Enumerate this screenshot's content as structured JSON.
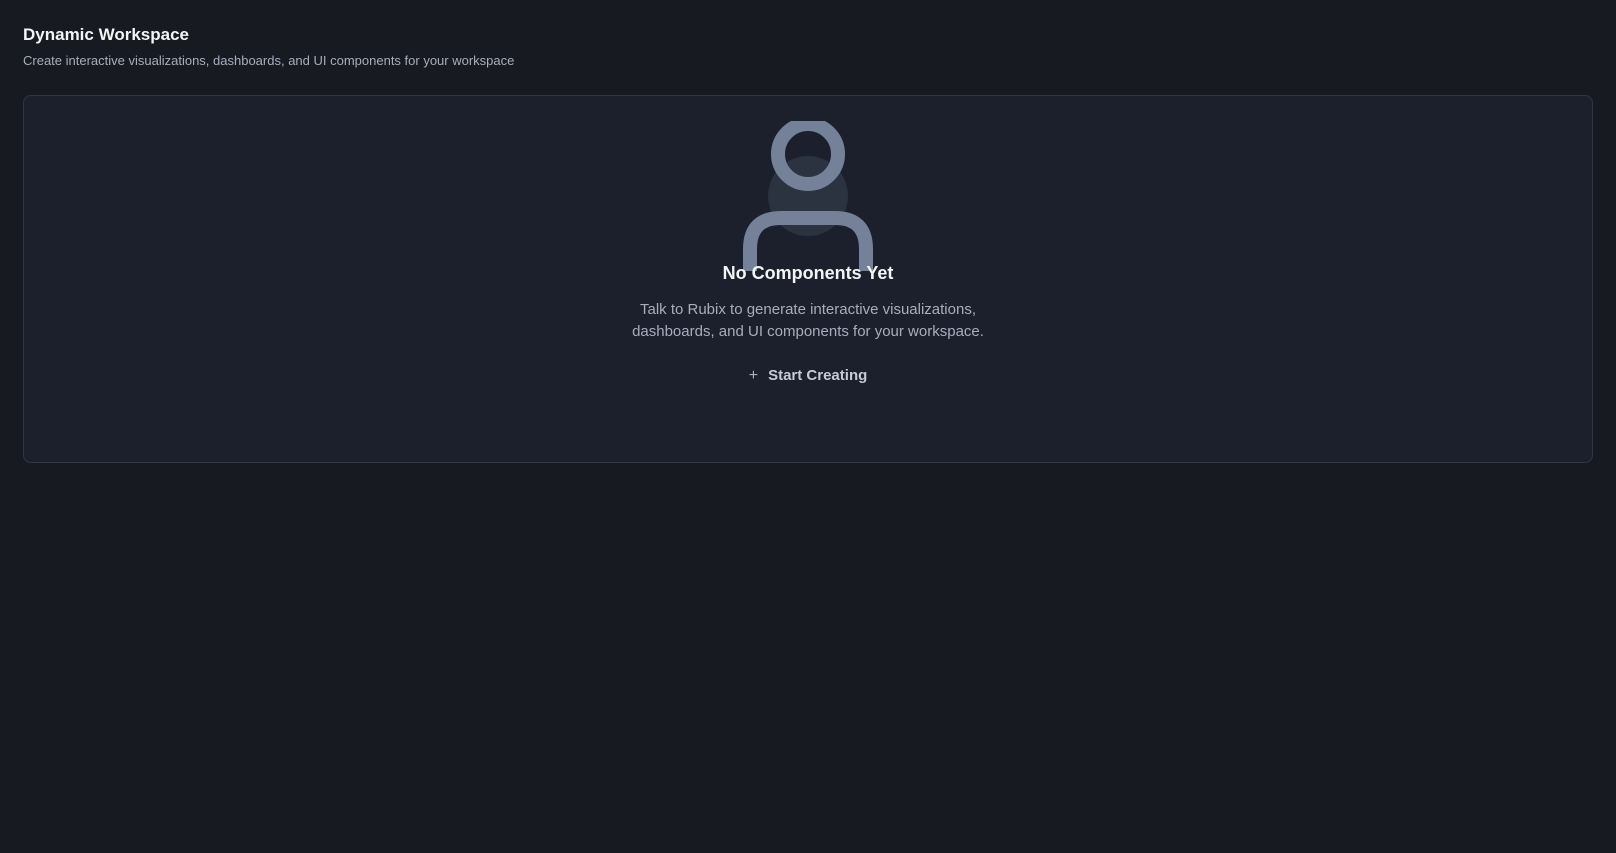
{
  "header": {
    "title": "Dynamic Workspace",
    "subtitle": "Create interactive visualizations, dashboards, and UI components for your workspace"
  },
  "empty_state": {
    "icon": "user-icon",
    "title": "No Components Yet",
    "description_line1": "Talk to Rubix to generate interactive visualizations,",
    "description_line2": "dashboards, and UI components for your workspace.",
    "button_label": "Start Creating",
    "button_icon": "plus-icon"
  },
  "colors": {
    "background": "#181a22",
    "panel": "#1b202c",
    "panel_border": "#2f3644",
    "icon_stroke": "#758198",
    "text_muted": "#a7adbb"
  }
}
